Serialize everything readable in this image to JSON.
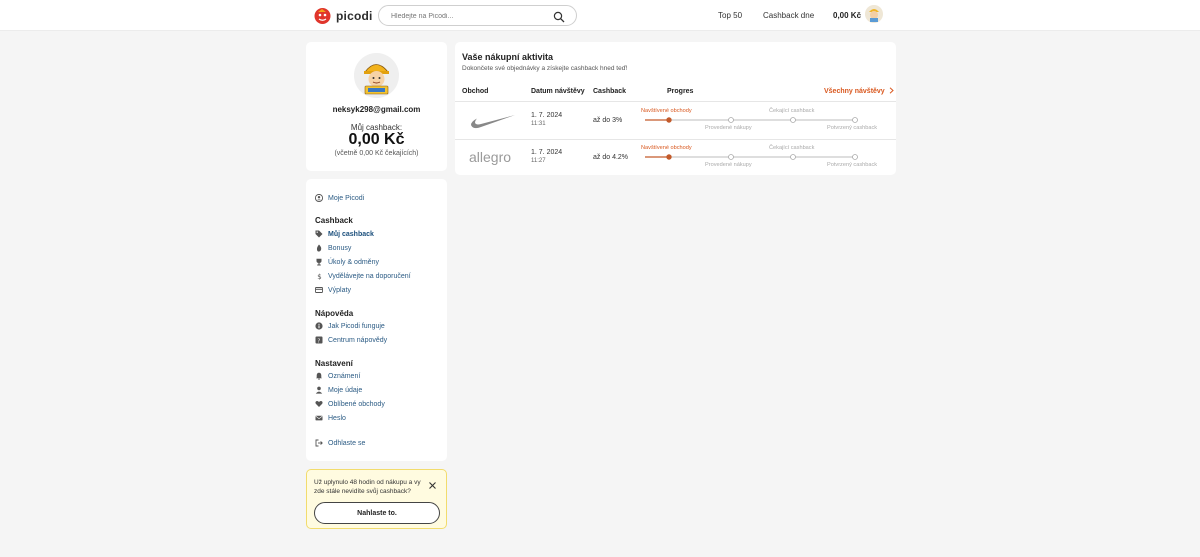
{
  "header": {
    "logo_text": "picodi",
    "search_placeholder": "Hledejte na Picodi...",
    "nav": {
      "top50": "Top 50",
      "cashback_day": "Cashback dne"
    },
    "balance": "0,00 Kč"
  },
  "profile": {
    "email": "neksyk298@gmail.com",
    "cashback_label": "Můj cashback:",
    "cashback_amount": "0,00 Kč",
    "cashback_note": "(včetně 0,00 Kč čekajících)"
  },
  "menu": {
    "my_picodi": "Moje Picodi",
    "cashback_heading": "Cashback",
    "cashback_items": [
      "Můj cashback",
      "Bonusy",
      "Úkoly & odměny",
      "Vydělávejte na doporučení",
      "Výplaty"
    ],
    "help_heading": "Nápověda",
    "help_items": [
      "Jak Picodi funguje",
      "Centrum nápovědy"
    ],
    "settings_heading": "Nastavení",
    "settings_items": [
      "Oznámení",
      "Moje údaje",
      "Oblíbené obchody",
      "Heslo"
    ],
    "logout": "Odhlaste se"
  },
  "notice": {
    "text": "Už uplynulo 48 hodin od nákupu a vy zde stále nevidíte svůj cashback?",
    "button": "Nahlaste to."
  },
  "activity": {
    "title": "Vaše nákupní aktivita",
    "subtitle": "Dokončete své objednávky a získejte cashback hned teď!",
    "columns": [
      "Obchod",
      "Datum návštěvy",
      "Cashback",
      "Progres"
    ],
    "all_visits": "Všechny návštěvy",
    "progress_steps": [
      "Navštívené obchody",
      "Provedené nákupy",
      "Čekající cashback",
      "Potvrzený cashback"
    ],
    "rows": [
      {
        "shop": "Nike",
        "logo": "nike-swoosh-logo",
        "date": "1. 7. 2024",
        "time": "11:31",
        "cashback": "až do 3%"
      },
      {
        "shop": "allegro",
        "logo_text": "allegro",
        "date": "1. 7. 2024",
        "time": "11:27",
        "cashback": "až do 4.2%"
      }
    ]
  },
  "colors": {
    "accent": "#d9581f",
    "link": "#2b5b84",
    "notice_bg": "#fffbe0"
  }
}
